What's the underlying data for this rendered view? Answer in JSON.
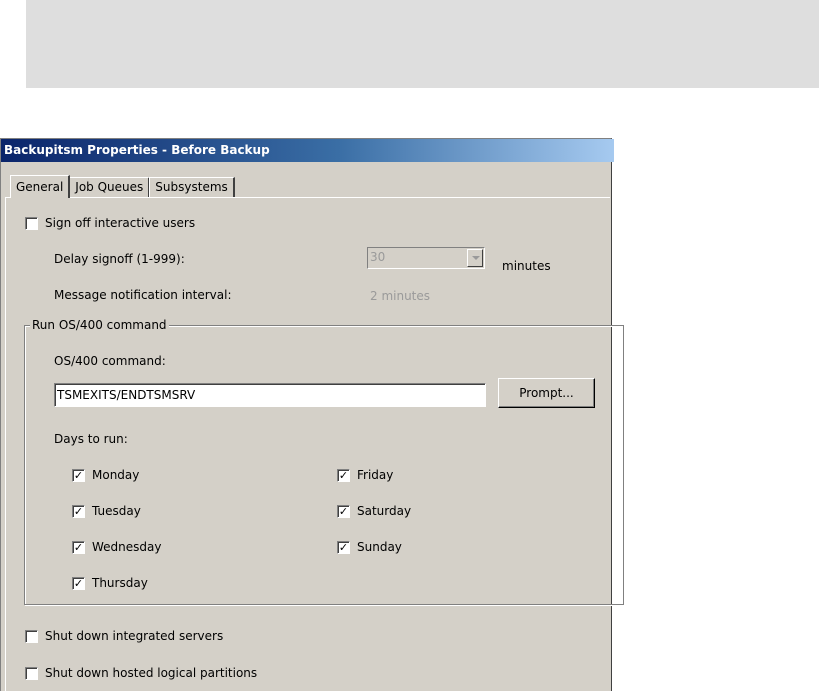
{
  "window": {
    "title": "Backupitsm Properties - Before Backup"
  },
  "tabs": [
    {
      "label": "General",
      "active": true
    },
    {
      "label": "Job Queues",
      "active": false
    },
    {
      "label": "Subsystems",
      "active": false
    }
  ],
  "sign_off": {
    "label": "Sign off interactive users",
    "checked": false,
    "delay_label": "Delay signoff (1-999):",
    "delay_value": "30",
    "delay_units": "minutes",
    "notify_label": "Message notification interval:",
    "notify_value": "2 minutes"
  },
  "run_command": {
    "group_label": "Run OS/400 command",
    "command_label": "OS/400 command:",
    "command_value": "TSMEXITS/ENDTSMSRV",
    "prompt_label": "Prompt...",
    "days_label": "Days to run:",
    "days": [
      {
        "label": "Monday",
        "checked": true
      },
      {
        "label": "Tuesday",
        "checked": true
      },
      {
        "label": "Wednesday",
        "checked": true
      },
      {
        "label": "Thursday",
        "checked": true
      },
      {
        "label": "Friday",
        "checked": true
      },
      {
        "label": "Saturday",
        "checked": true
      },
      {
        "label": "Sunday",
        "checked": true
      }
    ]
  },
  "shutdown": {
    "integrated_label": "Shut down integrated servers",
    "integrated_checked": false,
    "hosted_label": "Shut down hosted logical partitions",
    "hosted_checked": false
  },
  "icons": {
    "check_mark": "check-icon",
    "dropdown": "chevron-down-icon"
  }
}
